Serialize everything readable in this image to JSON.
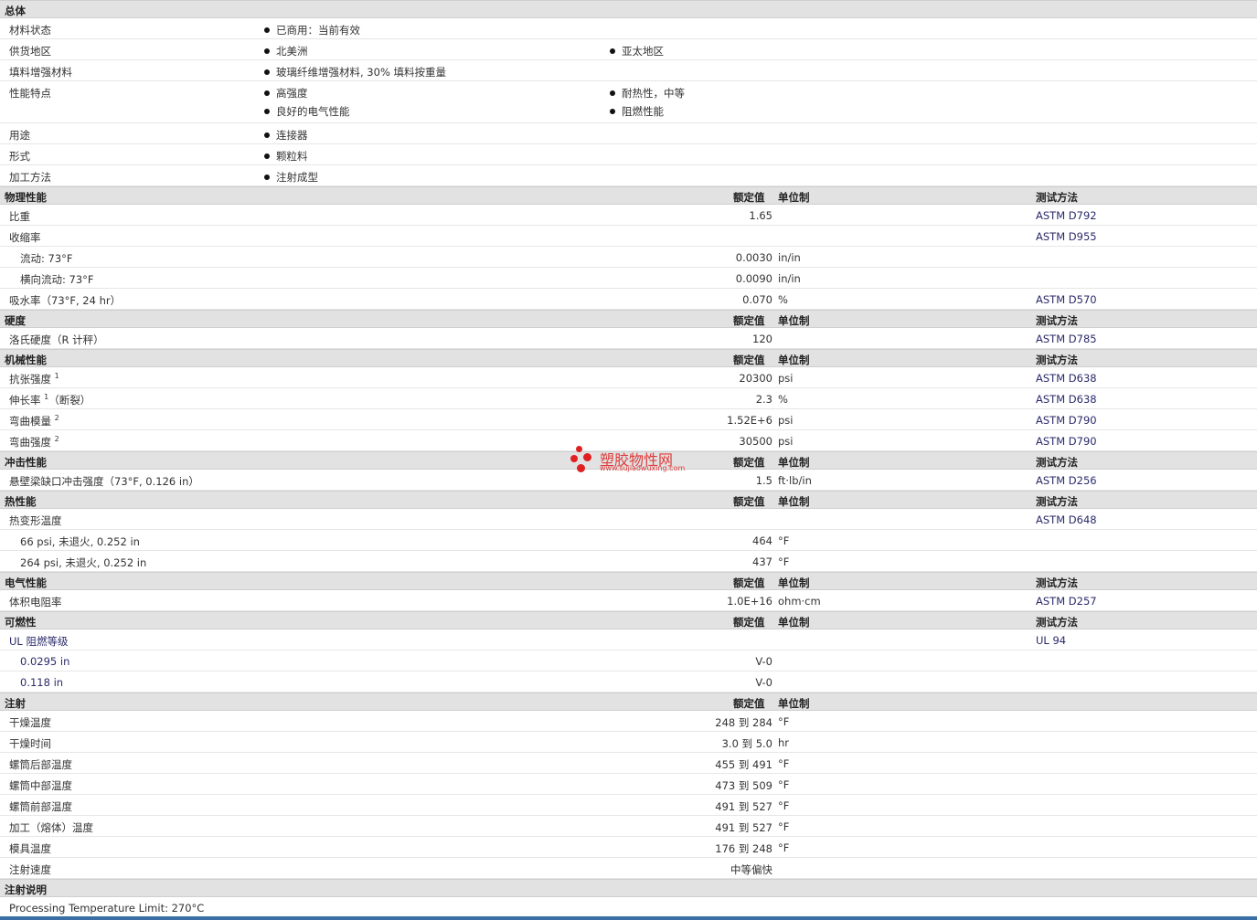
{
  "general": {
    "title": "总体",
    "status_label": "材料状态",
    "status_value": "已商用：当前有效",
    "supply_label": "供货地区",
    "supply_1": "北美洲",
    "supply_2": "亚太地区",
    "filler_label": "填料增强材料",
    "filler_value": "玻璃纤维增强材料, 30% 填料按重量",
    "features_label": "性能特点",
    "feature_1": "高强度",
    "feature_2": "耐热性，中等",
    "feature_3": "良好的电气性能",
    "feature_4": "阻燃性能",
    "use_label": "用途",
    "use_value": "连接器",
    "form_label": "形式",
    "form_value": "颗粒料",
    "method_label": "加工方法",
    "method_value": "注射成型"
  },
  "headers": {
    "rated": "额定值",
    "unit": "单位制",
    "test": "测试方法"
  },
  "physical": {
    "title": "物理性能",
    "sg_label": "比重",
    "sg_value": "1.65",
    "sg_test": "ASTM D792",
    "shrink_label": "收缩率",
    "shrink_test": "ASTM D955",
    "flow_label": "流动: 73°F",
    "flow_value": "0.0030",
    "flow_unit": "in/in",
    "xflow_label": "横向流动: 73°F",
    "xflow_value": "0.0090",
    "xflow_unit": "in/in",
    "water_label": "吸水率（73°F, 24 hr）",
    "water_value": "0.070",
    "water_unit": "%",
    "water_test": "ASTM D570"
  },
  "hardness": {
    "title": "硬度",
    "rockwell_label": "洛氏硬度（R 计秤）",
    "rockwell_value": "120",
    "rockwell_test": "ASTM D785"
  },
  "mechanical": {
    "title": "机械性能",
    "tensile_label": "抗张强度",
    "tensile_sup": "1",
    "tensile_value": "20300",
    "tensile_unit": "psi",
    "tensile_test": "ASTM D638",
    "elong_label": "伸长率",
    "elong_sup": "1",
    "elong_suffix": "（断裂）",
    "elong_value": "2.3",
    "elong_unit": "%",
    "elong_test": "ASTM D638",
    "fmod_label": "弯曲模量",
    "fmod_sup": "2",
    "fmod_value": "1.52E+6",
    "fmod_unit": "psi",
    "fmod_test": "ASTM D790",
    "fstr_label": "弯曲强度",
    "fstr_sup": "2",
    "fstr_value": "30500",
    "fstr_unit": "psi",
    "fstr_test": "ASTM D790"
  },
  "impact": {
    "title": "冲击性能",
    "izod_label": "悬壁梁缺口冲击强度（73°F, 0.126 in）",
    "izod_value": "1.5",
    "izod_unit": "ft·lb/in",
    "izod_test": "ASTM D256"
  },
  "thermal": {
    "title": "热性能",
    "hdt_label": "热变形温度",
    "hdt_test": "ASTM D648",
    "hdt1_label": "66 psi, 未退火, 0.252 in",
    "hdt1_value": "464",
    "hdt1_unit": "°F",
    "hdt2_label": "264 psi, 未退火, 0.252 in",
    "hdt2_value": "437",
    "hdt2_unit": "°F"
  },
  "electrical": {
    "title": "电气性能",
    "vr_label": "体积电阻率",
    "vr_value": "1.0E+16",
    "vr_unit": "ohm·cm",
    "vr_test": "ASTM D257"
  },
  "flammability": {
    "title": "可燃性",
    "ul_label": "UL 阻燃等级",
    "ul_test": "UL 94",
    "ul1_label": "0.0295 in",
    "ul1_value": "V-0",
    "ul2_label": "0.118 in",
    "ul2_value": "V-0"
  },
  "injection": {
    "title": "注射",
    "rows": [
      {
        "label": "干燥温度",
        "value": "248 到  284",
        "unit": "°F"
      },
      {
        "label": "干燥时间",
        "value": "3.0 到  5.0",
        "unit": "hr"
      },
      {
        "label": "螺筒后部温度",
        "value": "455 到  491",
        "unit": "°F"
      },
      {
        "label": "螺筒中部温度",
        "value": "473 到  509",
        "unit": "°F"
      },
      {
        "label": "螺筒前部温度",
        "value": "491 到  527",
        "unit": "°F"
      },
      {
        "label": "加工（熔体）温度",
        "value": "491 到  527",
        "unit": "°F"
      },
      {
        "label": "模具温度",
        "value": "176 到  248",
        "unit": "°F"
      },
      {
        "label": "注射速度",
        "value": "中等偏快",
        "unit": ""
      }
    ]
  },
  "notes": {
    "title": "注射说明",
    "text": "Processing Temperature Limit: 270°C"
  },
  "watermark": {
    "name": "塑胶物性网",
    "url": "www.sujiaowuxing.com"
  }
}
